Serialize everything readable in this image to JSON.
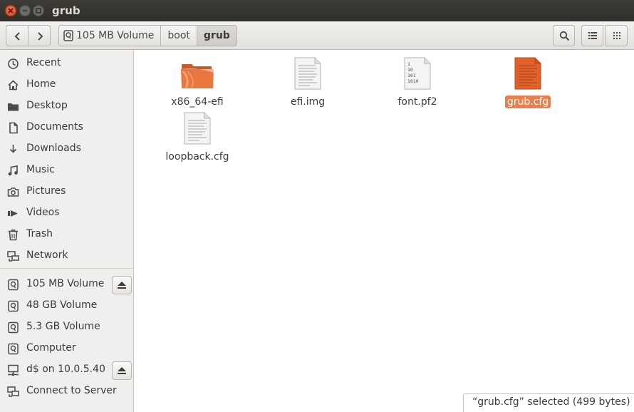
{
  "window": {
    "title": "grub"
  },
  "pathbar": {
    "crumbs": [
      "105 MB Volume",
      "boot",
      "grub"
    ]
  },
  "sidebar": {
    "places": [
      {
        "label": "Recent",
        "icon": "recent-icon"
      },
      {
        "label": "Home",
        "icon": "home-icon"
      },
      {
        "label": "Desktop",
        "icon": "desktop-folder-icon"
      },
      {
        "label": "Documents",
        "icon": "document-icon"
      },
      {
        "label": "Downloads",
        "icon": "download-icon"
      },
      {
        "label": "Music",
        "icon": "music-icon"
      },
      {
        "label": "Pictures",
        "icon": "camera-icon"
      },
      {
        "label": "Videos",
        "icon": "video-icon"
      },
      {
        "label": "Trash",
        "icon": "trash-icon"
      },
      {
        "label": "Network",
        "icon": "network-icon"
      }
    ],
    "devices": [
      {
        "label": "105 MB Volume",
        "icon": "drive-icon",
        "eject": true
      },
      {
        "label": "48 GB Volume",
        "icon": "drive-icon",
        "eject": false
      },
      {
        "label": "5.3 GB Volume",
        "icon": "drive-icon",
        "eject": false
      },
      {
        "label": "Computer",
        "icon": "drive-icon",
        "eject": false
      },
      {
        "label": "d$ on 10.0.5.40",
        "icon": "network-share-icon",
        "eject": true
      },
      {
        "label": "Connect to Server",
        "icon": "network-icon",
        "eject": false
      }
    ]
  },
  "files": [
    {
      "name": "x86_64-efi",
      "type": "folder",
      "selected": false
    },
    {
      "name": "efi.img",
      "type": "text",
      "selected": false
    },
    {
      "name": "font.pf2",
      "type": "binary",
      "selected": false,
      "binary_lines": [
        "1",
        "10",
        "101",
        "1010"
      ]
    },
    {
      "name": "grub.cfg",
      "type": "text",
      "selected": true
    },
    {
      "name": "loopback.cfg",
      "type": "text",
      "selected": false
    }
  ],
  "statusbar": {
    "text": "“grub.cfg” selected  (499 bytes)"
  },
  "colors": {
    "accent": "#e8804d",
    "titlebar": "#3c3b37",
    "close": "#e5582a"
  }
}
